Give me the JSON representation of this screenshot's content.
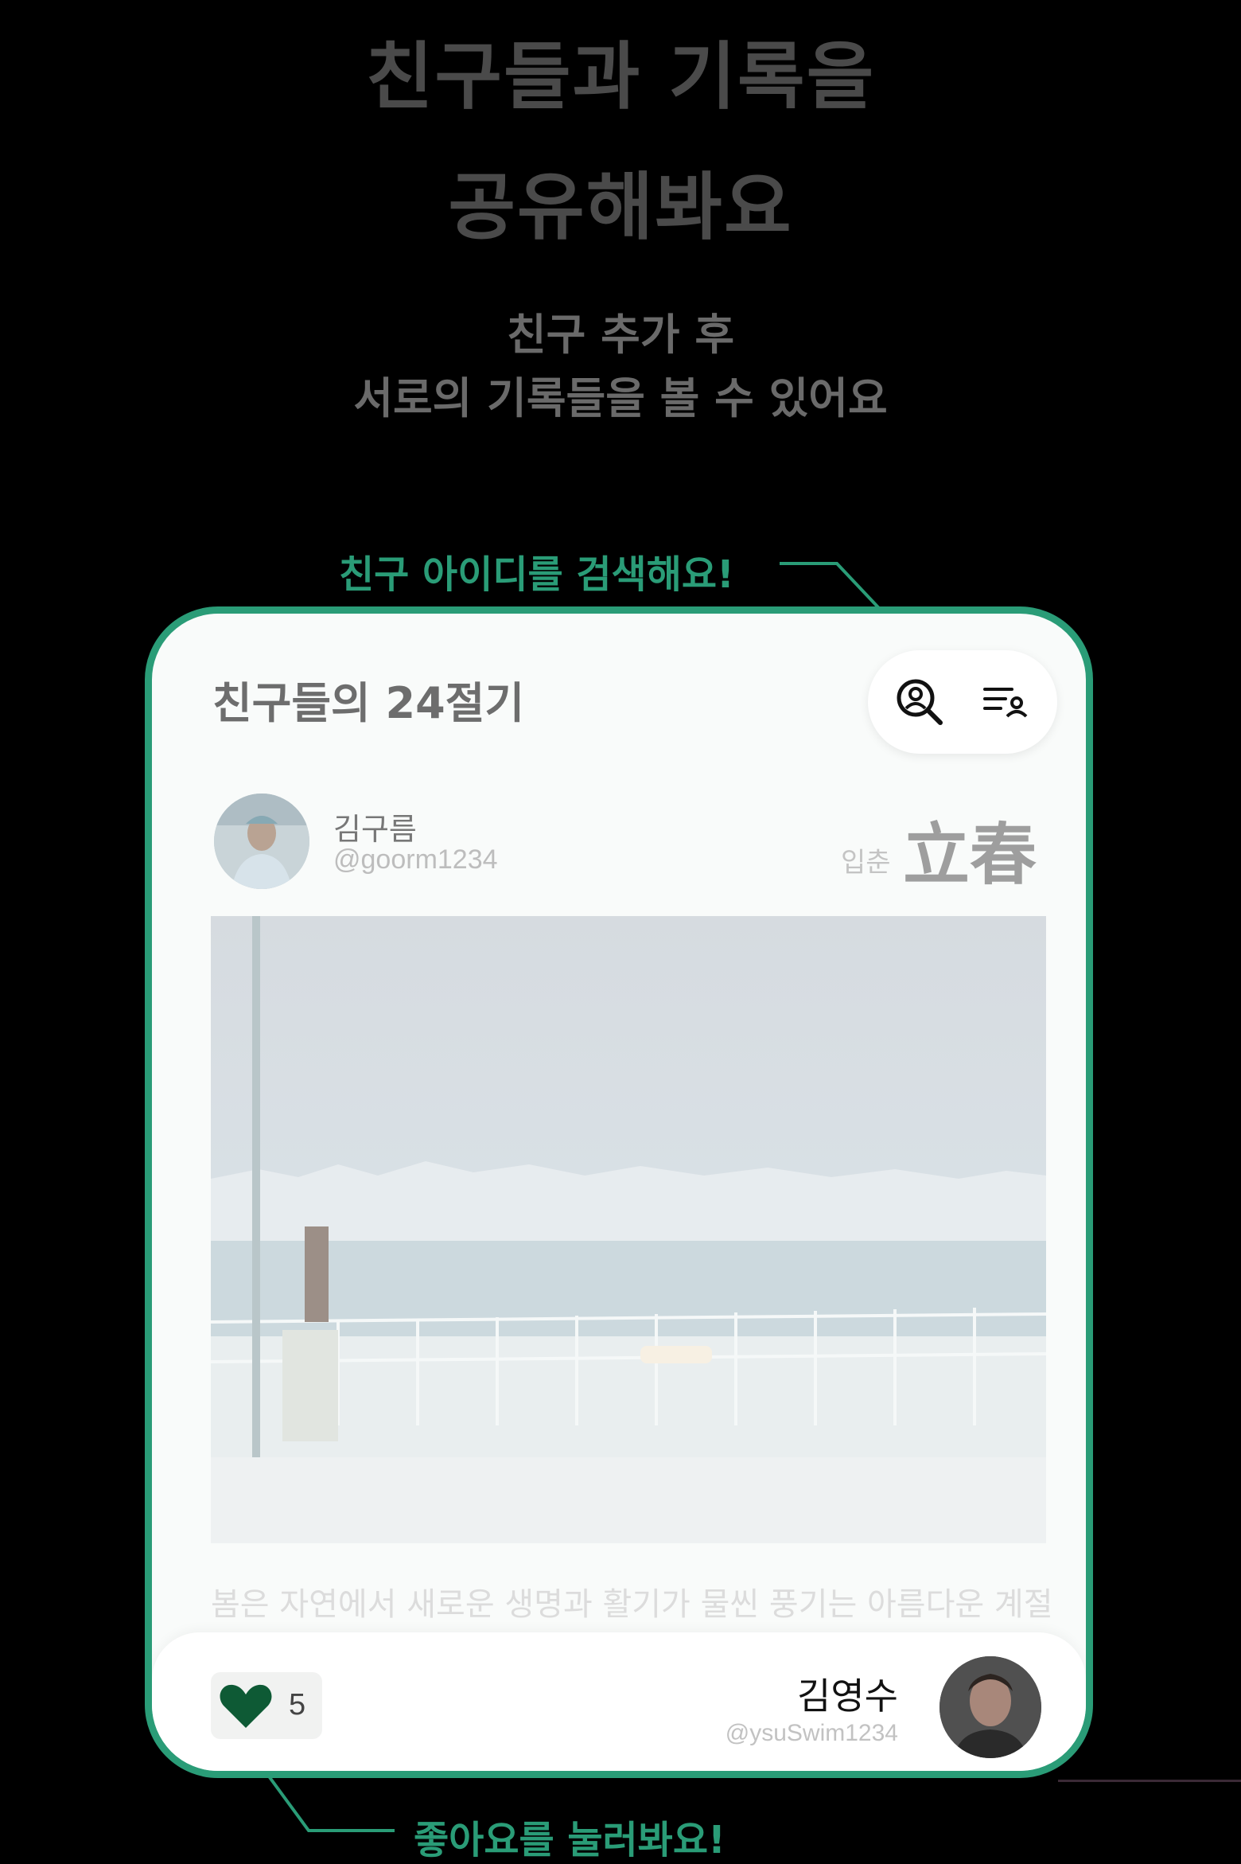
{
  "promo": {
    "title_line1": "친구들과 기록을",
    "title_line2": "공유해봐요",
    "subtitle_line1": "친구 추가 후",
    "subtitle_line2": "서로의 기록들을 볼 수 있어요",
    "callout_search": "친구 아이디를 검색해요!",
    "callout_like": "좋아요를 눌러봐요!"
  },
  "colors": {
    "accent": "#2a9c77",
    "like_heart": "#0e5a35",
    "background": "#000000"
  },
  "app": {
    "title": "친구들의 24절기",
    "icons": [
      "search-user-icon",
      "friend-list-icon"
    ]
  },
  "post": {
    "author_name": "김구름",
    "author_handle": "@goorm1234",
    "season_korean": "입춘",
    "season_hanja": "立春",
    "text": "봄은 자연에서 새로운 생명과 활기가 물씬 풍기는 아름다운 계절"
  },
  "footer": {
    "like_count": "5",
    "friend_name": "김영수",
    "friend_handle": "@ysuSwim1234"
  }
}
